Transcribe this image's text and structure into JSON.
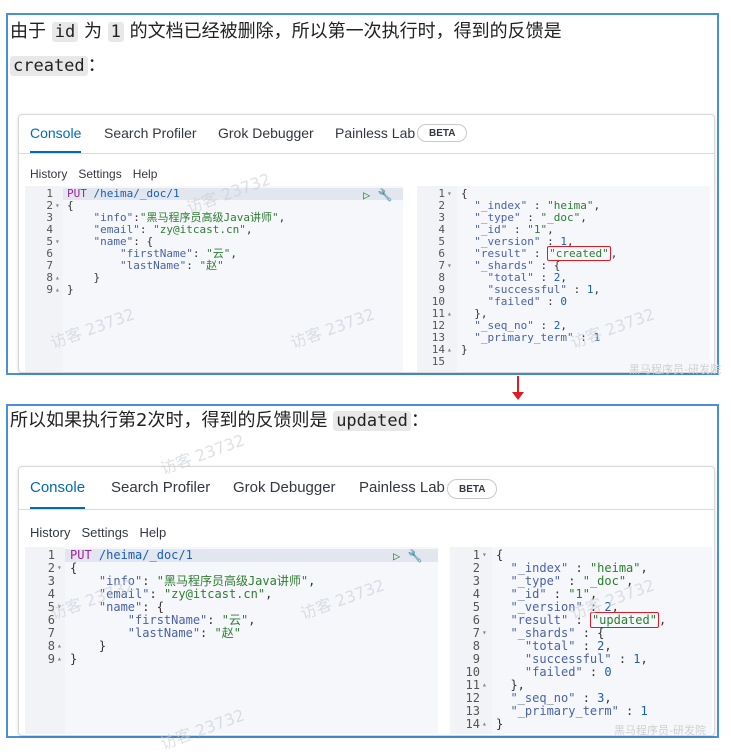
{
  "panel1": {
    "caption_prefix": "由于 ",
    "caption_code1": "id",
    "caption_mid1": " 为 ",
    "caption_code2": "1",
    "caption_mid2": " 的文档已经被删除，所以第一次执行时，得到的反馈是",
    "caption_code3": "created",
    "caption_suffix": "：",
    "result_value": "\"created\"",
    "version": "1",
    "seq_no": "2"
  },
  "panel2": {
    "caption_prefix": "所以如果执行第2次时，得到的反馈则是 ",
    "caption_code": "updated",
    "caption_suffix": "：",
    "result_value": "\"updated\"",
    "version": "2",
    "seq_no": "3"
  },
  "tabs": {
    "console": "Console",
    "search_profiler": "Search Profiler",
    "grok_debugger": "Grok Debugger",
    "painless_lab": "Painless Lab",
    "beta": "BETA"
  },
  "menu": {
    "history": "History",
    "settings": "Settings",
    "help": "Help"
  },
  "request": {
    "method": "PUT",
    "path": "/heima/_doc/1",
    "info_key": "\"info\"",
    "info_val": "\"黑马程序员高级Java讲师\"",
    "email_key": "\"email\"",
    "email_val": "\"zy@itcast.cn\"",
    "name_key": "\"name\"",
    "first_key": "\"firstName\"",
    "first_val": "\"云\"",
    "last_key": "\"lastName\"",
    "last_val": "\"赵\""
  },
  "response": {
    "index_key": "\"_index\"",
    "index_val": "\"heima\"",
    "type_key": "\"_type\"",
    "type_val": "\"_doc\"",
    "id_key": "\"_id\"",
    "id_val": "\"1\"",
    "version_key": "\"_version\"",
    "result_key": "\"result\"",
    "shards_key": "\"_shards\"",
    "total_key": "\"total\"",
    "total_val": "2",
    "successful_key": "\"successful\"",
    "successful_val": "1",
    "failed_key": "\"failed\"",
    "failed_val": "0",
    "seq_key": "\"_seq_no\"",
    "primary_key": "\"_primary_term\"",
    "primary_val": "1"
  },
  "watermarks": {
    "visitor": "访客 23732",
    "footer": "黑马程序员-研发院"
  },
  "colors": {
    "panel_border": "#4a90d9",
    "active_tab": "#006bb4",
    "highlight_box": "#e01b24"
  }
}
